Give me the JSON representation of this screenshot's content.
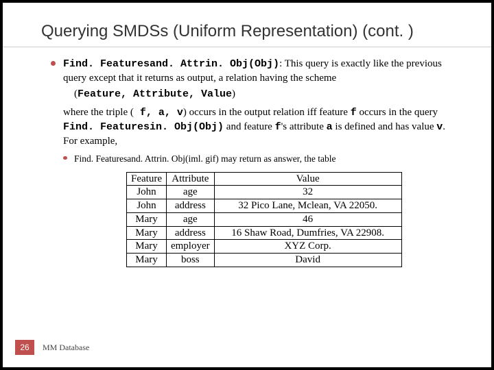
{
  "title": "Querying SMDSs (Uniform Representation) (cont. )",
  "bullet": {
    "fn": "Find. Featuresand. Attrin. Obj(Obj)",
    "after_fn": ": This query is exactly like the previous query except that it returns as output,  a relation having the scheme",
    "scheme_open": "(",
    "scheme_triplet": "Feature, Attribute, Value",
    "scheme_close": ")",
    "triple_prefix": "where the triple (",
    "triple_vars": " f, a, v",
    "triple_mid1": ") occurs in the output relation iff feature ",
    "var_f": "f",
    "mid2": " occurs in the query ",
    "query_fn": "Find. Featuresin. Obj(Obj)",
    "mid3": " and feature ",
    "var_f2": "f",
    "mid4": "'s attribute ",
    "var_a": "a",
    "mid5": " is defined and has value ",
    "var_v": "v",
    "tail": ".  For example,"
  },
  "sub_example": "Find. Featuresand. Attrin. Obj(iml. gif) may return as answer, the table",
  "table": {
    "headers": [
      "Feature",
      "Attribute",
      "Value"
    ],
    "rows": [
      [
        "John",
        "age",
        "32"
      ],
      [
        "John",
        "address",
        "32 Pico Lane, Mclean, VA 22050."
      ],
      [
        "Mary",
        "age",
        "46"
      ],
      [
        "Mary",
        "address",
        "16 Shaw Road, Dumfries, VA 22908."
      ],
      [
        "Mary",
        "employer",
        "XYZ Corp."
      ],
      [
        "Mary",
        "boss",
        "David"
      ]
    ]
  },
  "page_number": "26",
  "course": "MM Database"
}
